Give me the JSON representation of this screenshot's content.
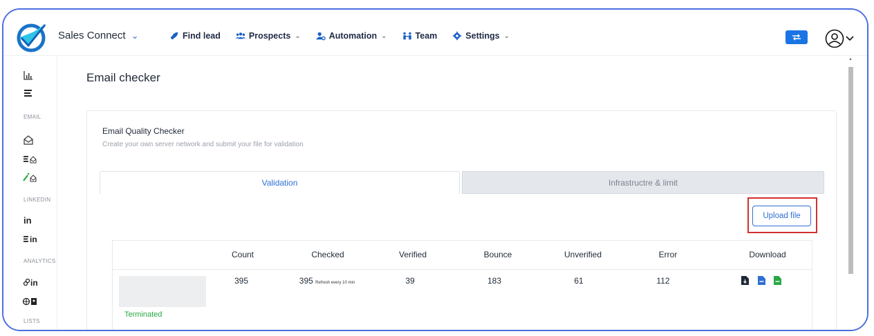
{
  "header": {
    "brand": "Sales Connect",
    "nav": [
      {
        "label": "Find lead",
        "icon": "rocket-icon",
        "has_caret": false
      },
      {
        "label": "Prospects",
        "icon": "users-icon",
        "has_caret": true
      },
      {
        "label": "Automation",
        "icon": "user-gear-icon",
        "has_caret": true
      },
      {
        "label": "Team",
        "icon": "team-icon",
        "has_caret": false
      },
      {
        "label": "Settings",
        "icon": "gear-icon",
        "has_caret": true
      }
    ]
  },
  "sidebar": {
    "sections": {
      "email": "EMAIL",
      "linkedin": "LINKEDIN",
      "analytics": "ANALYTICS",
      "lists": "LISTS"
    }
  },
  "page": {
    "title": "Email checker",
    "card_title": "Email Quality Checker",
    "card_subtitle": "Create your own server network and submit your file for validation",
    "tabs": [
      "Validation",
      "Infrastructre & limit"
    ],
    "upload_label": "Upload file"
  },
  "table": {
    "headers": [
      "Count",
      "Checked",
      "Verified",
      "Bounce",
      "Unverified",
      "Error",
      "Download"
    ],
    "row": {
      "count": "395",
      "checked": "395",
      "checked_note": "Refresh every 10 min",
      "verified": "39",
      "bounce": "183",
      "unverified": "61",
      "error": "112",
      "status": "Terminated"
    }
  },
  "colors": {
    "accent": "#2f6fd6",
    "highlight": "#d32f2f",
    "success": "#28a745",
    "frame": "#4c6ee0"
  }
}
